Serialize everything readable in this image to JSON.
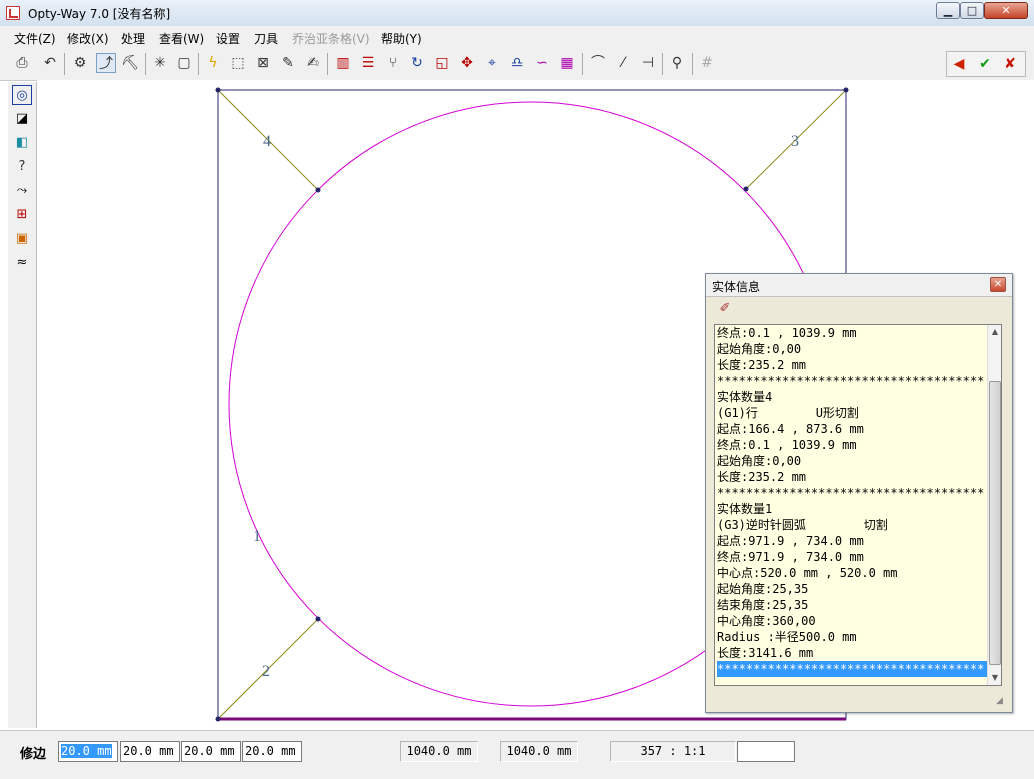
{
  "window": {
    "title": "Opty-Way 7.0  [没有名称]",
    "min_glyph": "▁",
    "max_glyph": "□",
    "close_glyph": "✕"
  },
  "menu": [
    {
      "label": "文件(Z)",
      "enabled": true
    },
    {
      "label": "修改(X)",
      "enabled": true
    },
    {
      "label": "处理",
      "enabled": true
    },
    {
      "label": "查看(W)",
      "enabled": true
    },
    {
      "label": "设置",
      "enabled": true
    },
    {
      "label": "刀具",
      "enabled": true
    },
    {
      "label": "乔治亚条格(V)",
      "enabled": false
    },
    {
      "label": "帮助(Y)",
      "enabled": true
    }
  ],
  "toolbar": {
    "buttons": [
      "print-icon",
      "undo-icon",
      "settings-icon",
      "path-icon",
      "tool-icon",
      "explode-icon",
      "select-rect-icon",
      "lightning-icon",
      "frame-icon",
      "cross-box-icon",
      "pen-icon",
      "brush-icon",
      "columns-icon",
      "align-icon",
      "branch-icon",
      "rotate-icon",
      "scale-icon",
      "move-icon",
      "target-icon",
      "shape-icon",
      "curve-icon",
      "grid-small-icon",
      "arc-icon",
      "feather-icon",
      "cut-line-icon",
      "stamp-icon",
      "grid-icon"
    ],
    "right_buttons": [
      {
        "name": "back-arrow-icon",
        "glyph": "◀",
        "color": "#cc2200"
      },
      {
        "name": "check-icon",
        "glyph": "✔",
        "color": "#119911"
      },
      {
        "name": "cross-icon",
        "glyph": "✘",
        "color": "#cc1100"
      }
    ]
  },
  "left_toolbar": [
    "circle-frame-icon",
    "rect-diagonal-icon",
    "palette-icon",
    "help-icon",
    "path-tool-icon",
    "flowchart-icon",
    "color-blocks-icon",
    "wave-icon"
  ],
  "drawing": {
    "lead_labels": [
      "4",
      "3",
      "1",
      "2"
    ],
    "colors": {
      "frame": "#24246b",
      "arc": "#d400d4",
      "lead": "#8a8a1a",
      "bottom_edge": "#7a0a7a",
      "label": "#4a6a8a"
    }
  },
  "info_panel": {
    "title": "实体信息",
    "close_glyph": "✕",
    "tool_glyph": "✐",
    "lines": [
      "终点:0.1 , 1039.9 mm",
      "起始角度:0,00",
      "长度:235.2 mm",
      "*************************************",
      "实体数量4",
      "(G1)行        U形切割",
      "起点:166.4 , 873.6 mm",
      "终点:0.1 , 1039.9 mm",
      "起始角度:0,00",
      "长度:235.2 mm",
      "*************************************",
      "实体数量1",
      "(G3)逆时针圆弧        切割",
      "起点:971.9 , 734.0 mm",
      "终点:971.9 , 734.0 mm",
      "中心点:520.0 mm , 520.0 mm",
      "起始角度:25,35",
      "结束角度:25,35",
      "中心角度:360,00",
      "Radius :半径500.0 mm",
      "长度:3141.6 mm",
      "*************************************"
    ],
    "selected_line": 21
  },
  "status": {
    "label": "修边",
    "fields": [
      "20.0 mm",
      "20.0 mm",
      "20.0 mm",
      "20.0 mm"
    ],
    "width": "1040.0 mm",
    "height": "1040.0 mm",
    "readout": "357 :   1:1",
    "blank": ""
  }
}
